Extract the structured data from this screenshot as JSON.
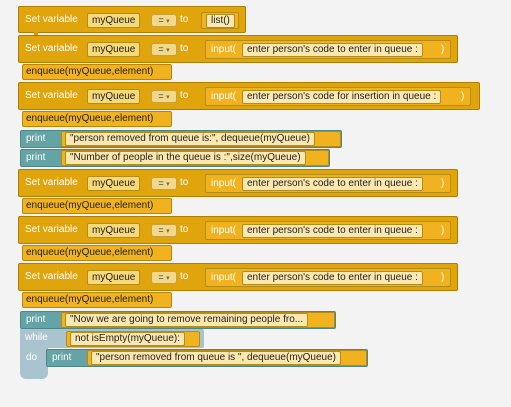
{
  "kw": {
    "set_variable": "Set variable",
    "to": "to",
    "equals": "=",
    "arrow": "▾",
    "print": "print",
    "while": "while",
    "do": "do",
    "input": "input(",
    "input_close": ")"
  },
  "var_name": "myQueue",
  "init_value": "list()",
  "prompts": {
    "enter": "enter person's code to enter in queue :",
    "insertion": "enter person's code for insertion in queue :"
  },
  "enqueue_call": "enqueue(myQueue,element)",
  "prints": {
    "removed": "\"person removed from queue is:\", dequeue(myQueue)",
    "count": "\"Number of people in the queue is :\",size(myQueue)",
    "remaining": "\"Now we are going to remove remaining people fro..."
  },
  "while_block": {
    "condition": "not isEmpty(myQueue):",
    "body_print": "\"person removed from queue is \", dequeue(myQueue)"
  },
  "colors": {
    "workspace": "#f3f3f3",
    "variable_block": "#e0a40c",
    "print_block": "#65a4a6",
    "loop_block": "#a9c3cf"
  }
}
